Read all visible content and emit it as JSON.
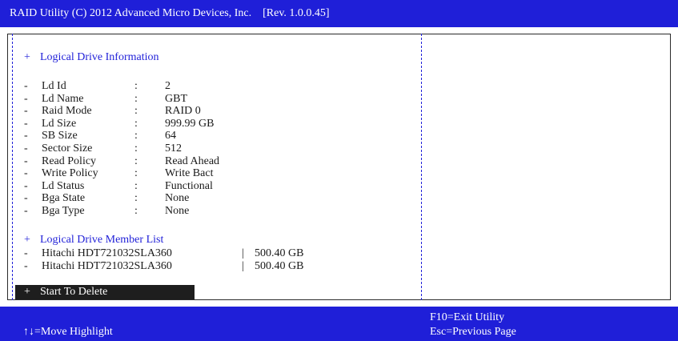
{
  "title": {
    "text": "RAID Utility (C) 2012 Advanced Micro Devices, Inc.",
    "rev": "[Rev.  1.0.0.45]"
  },
  "info": {
    "heading_plus": "+",
    "heading": "Logical Drive Information",
    "rows": [
      {
        "label": "Ld Id",
        "value": "2"
      },
      {
        "label": "Ld Name",
        "value": "GBT"
      },
      {
        "label": "Raid Mode",
        "value": "RAID 0"
      },
      {
        "label": "Ld Size",
        "value": "999.99 GB"
      },
      {
        "label": "SB Size",
        "value": "64"
      },
      {
        "label": "Sector Size",
        "value": "512"
      },
      {
        "label": "Read Policy",
        "value": "Read Ahead"
      },
      {
        "label": "Write Policy",
        "value": "Write Bact"
      },
      {
        "label": "Ld Status",
        "value": "Functional"
      },
      {
        "label": "Bga State",
        "value": "None"
      },
      {
        "label": "Bga Type",
        "value": "None"
      }
    ]
  },
  "members": {
    "heading_plus": "+",
    "heading": "Logical Drive Member List",
    "items": [
      {
        "name": "Hitachi HDT721032SLA360",
        "size": "500.40 GB"
      },
      {
        "name": "Hitachi HDT721032SLA360",
        "size": "500.40 GB"
      }
    ]
  },
  "action": {
    "plus": "+",
    "label": "Start To Delete"
  },
  "footer": {
    "move": "↑↓=Move Highlight",
    "exit": "F10=Exit Utility",
    "esc": "Esc=Previous Page"
  },
  "symbols": {
    "dash": "-",
    "colon": ":",
    "sep": "|"
  },
  "colors": {
    "bar": "#1f1fd8",
    "heading": "#1f1fd8",
    "highlight": "#1e1e1e"
  }
}
